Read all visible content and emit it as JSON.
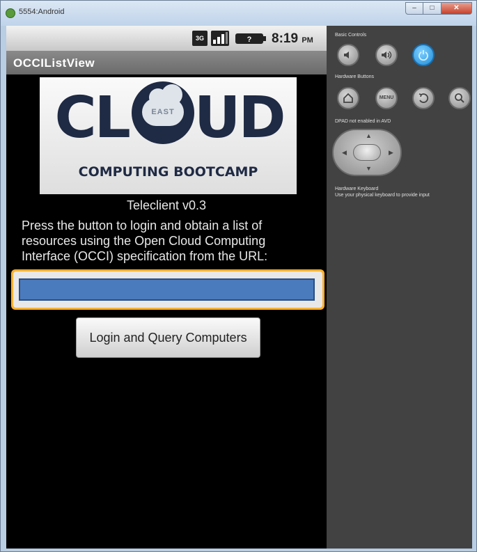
{
  "window": {
    "title": "5554:Android",
    "min_glyph": "–",
    "max_glyph": "□",
    "close_glyph": "✕"
  },
  "status_bar": {
    "network_label": "3G",
    "time": "8:19",
    "ampm": "PM"
  },
  "app": {
    "title": "OCCIListView",
    "banner": {
      "word_left": "CL",
      "word_right": "UD",
      "badge": "EAST",
      "subtitle": "COMPUTING BOOTCAMP"
    },
    "subtitle": "Teleclient v0.3",
    "description": "Press the button to login and obtain a list of resources using the Open Cloud Computing Interface (OCCI) specification from the URL:",
    "url_value": "",
    "login_button": "Login and Query Computers"
  },
  "controls": {
    "basic_label": "Basic Controls",
    "hardware_label": "Hardware Buttons",
    "dpad_label": "DPAD not enabled in AVD",
    "keyboard_label": "Hardware Keyboard",
    "keyboard_hint": "Use your physical keyboard to provide input",
    "menu_label": "MENU"
  },
  "colors": {
    "focus_ring": "#ffb030",
    "input_fill": "#4a7bbd",
    "power_button": "#1e8cd8"
  }
}
